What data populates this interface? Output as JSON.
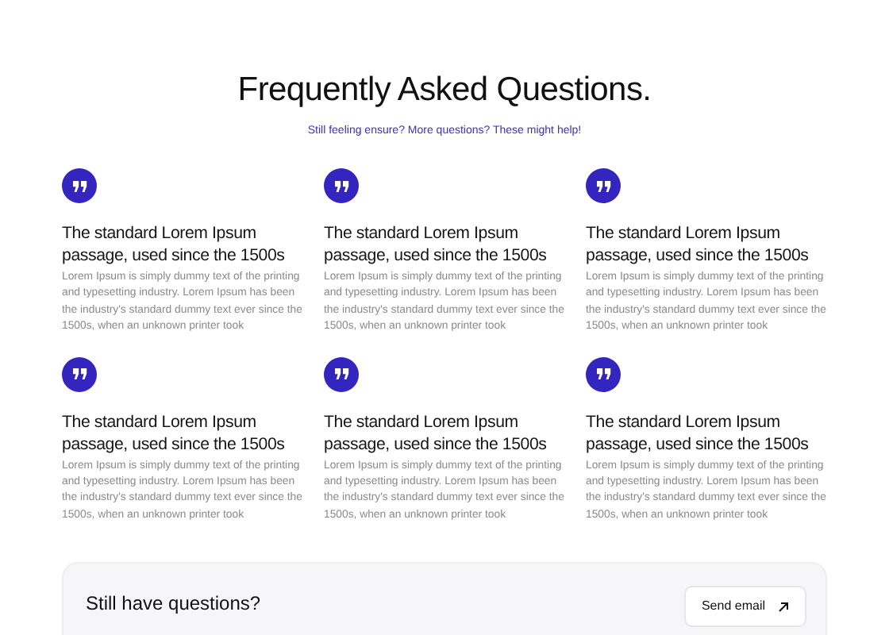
{
  "heading": "Frequently Asked Questions.",
  "subheading": "Still feeling ensure? More questions? These might help!",
  "faqs": [
    {
      "title": "The standard Lorem Ipsum passage, used since the 1500s",
      "body": "Lorem Ipsum is simply dummy text of the printing and typesetting industry. Lorem Ipsum has been the industry's standard dummy text ever since the 1500s, when an unknown printer took"
    },
    {
      "title": "The standard Lorem Ipsum passage, used since the 1500s",
      "body": "Lorem Ipsum is simply dummy text of the printing and typesetting industry. Lorem Ipsum has been the industry's standard dummy text ever since the 1500s, when an unknown printer took"
    },
    {
      "title": "The standard Lorem Ipsum passage, used since the 1500s",
      "body": "Lorem Ipsum is simply dummy text of the printing and typesetting industry. Lorem Ipsum has been the industry's standard dummy text ever since the 1500s, when an unknown printer took"
    },
    {
      "title": "The standard Lorem Ipsum passage, used since the 1500s",
      "body": "Lorem Ipsum is simply dummy text of the printing and typesetting industry. Lorem Ipsum has been the industry's standard dummy text ever since the 1500s, when an unknown printer took"
    },
    {
      "title": "The standard Lorem Ipsum passage, used since the 1500s",
      "body": "Lorem Ipsum is simply dummy text of the printing and typesetting industry. Lorem Ipsum has been the industry's standard dummy text ever since the 1500s, when an unknown printer took"
    },
    {
      "title": "The standard Lorem Ipsum passage, used since the 1500s",
      "body": "Lorem Ipsum is simply dummy text of the printing and typesetting industry. Lorem Ipsum has been the industry's standard dummy text ever since the 1500s, when an unknown printer took"
    }
  ],
  "contact": {
    "title": "Still have questions?",
    "button": "Send email"
  }
}
